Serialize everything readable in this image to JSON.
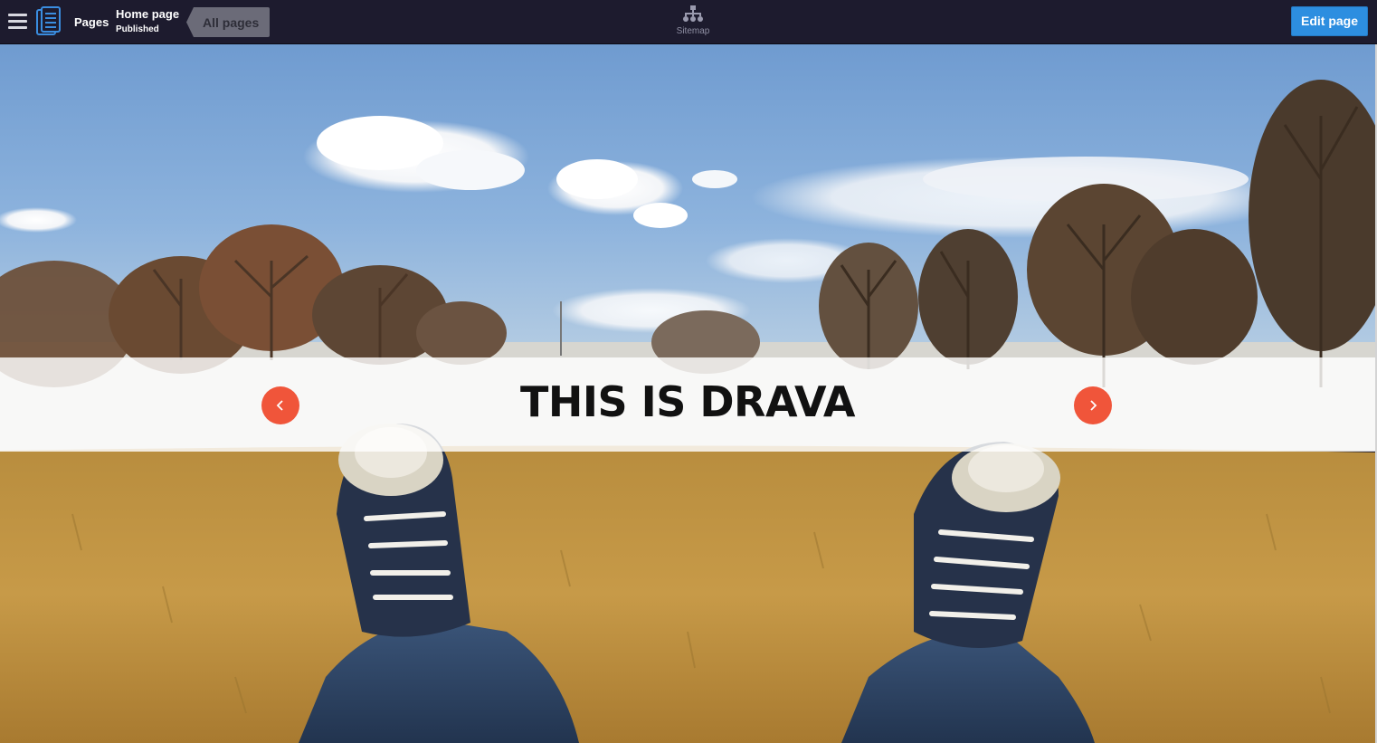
{
  "topbar": {
    "menu_icon": "hamburger-menu-icon",
    "pages_icon": "pages-document-icon",
    "pages_label": "Pages",
    "page_title": "Home page",
    "page_status": "Published",
    "all_pages_label": "All pages",
    "sitemap_icon": "sitemap-icon",
    "sitemap_label": "Sitemap",
    "edit_label": "Edit page"
  },
  "hero": {
    "title": "THIS IS DRAVA",
    "prev_icon": "chevron-left-icon",
    "next_icon": "chevron-right-icon",
    "accent_color": "#f0553a"
  },
  "colors": {
    "topbar_bg": "#1d1b2e",
    "edit_button": "#2d8ee0"
  }
}
